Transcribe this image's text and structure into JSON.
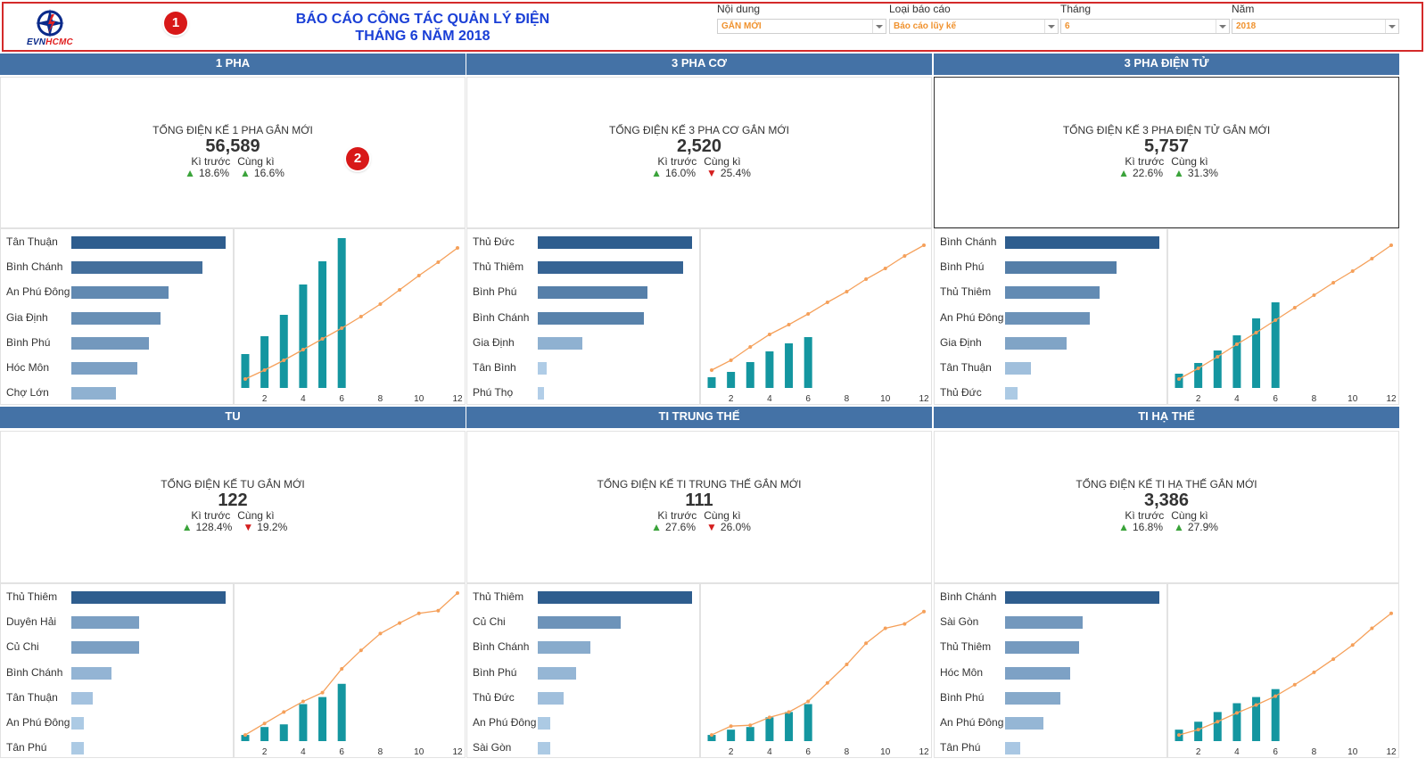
{
  "header": {
    "logo_text": {
      "evn": "EVN",
      "hcmc": "HCMC"
    },
    "title_line1": "BÁO CÁO CÔNG TÁC QUẢN LÝ ĐIỆN",
    "title_line2": "THÁNG 6 NĂM 2018",
    "badge1": "1",
    "badge2": "2",
    "filters": [
      {
        "label": "Nội dung",
        "value": "GẮN MỚI"
      },
      {
        "label": "Loại báo cáo",
        "value": "Báo cáo lũy kế"
      },
      {
        "label": "Tháng",
        "value": "6"
      },
      {
        "label": "Năm",
        "value": "2018"
      }
    ]
  },
  "colors": {
    "header_bar": "#4472a6",
    "bar_dark": "#2e5d8e",
    "bar_light": "#b7d3ec",
    "column": "#1496a0",
    "line": "#f5a05a",
    "up": "#3aa33a",
    "down": "#d41f1f"
  },
  "sections": [
    {
      "title": "1 PHA",
      "kpi_label": "TỔNG ĐIỆN KẾ 1 PHA GẮN MỚI",
      "kpi_value": "56,589",
      "prev_label": "Kì trước",
      "same_label": "Cùng kì",
      "prev_change": "18.6%",
      "prev_dir": "up",
      "same_change": "16.6%",
      "same_dir": "up"
    },
    {
      "title": "3 PHA CƠ",
      "kpi_label": "TỔNG ĐIỆN KẾ 3 PHA CƠ GẮN MỚI",
      "kpi_value": "2,520",
      "prev_label": "Kì trước",
      "same_label": "Cùng kì",
      "prev_change": "16.0%",
      "prev_dir": "up",
      "same_change": "25.4%",
      "same_dir": "down"
    },
    {
      "title": "3 PHA ĐIỆN TỬ",
      "kpi_label": "TỔNG ĐIỆN KẾ 3 PHA ĐIỆN TỬ GẮN MỚI",
      "kpi_value": "5,757",
      "prev_label": "Kì trước",
      "same_label": "Cùng kì",
      "prev_change": "22.6%",
      "prev_dir": "up",
      "same_change": "31.3%",
      "same_dir": "up"
    },
    {
      "title": "TU",
      "kpi_label": "TỔNG ĐIỆN KẾ TU GẮN MỚI",
      "kpi_value": "122",
      "prev_label": "Kì trước",
      "same_label": "Cùng kì",
      "prev_change": "128.4%",
      "prev_dir": "up",
      "same_change": "19.2%",
      "same_dir": "down"
    },
    {
      "title": "TI TRUNG THẾ",
      "kpi_label": "TỔNG ĐIỆN KẾ TI TRUNG THẾ GẮN MỚI",
      "kpi_value": "111",
      "prev_label": "Kì trước",
      "same_label": "Cùng kì",
      "prev_change": "27.6%",
      "prev_dir": "up",
      "same_change": "26.0%",
      "same_dir": "down"
    },
    {
      "title": "TI HẠ THẾ",
      "kpi_label": "TỔNG ĐIỆN KẾ TI HẠ THẾ GẮN MỚI",
      "kpi_value": "3,386",
      "prev_label": "Kì trước",
      "same_label": "Cùng kì",
      "prev_change": "16.8%",
      "prev_dir": "up",
      "same_change": "27.9%",
      "same_dir": "up"
    }
  ],
  "chart_data": [
    {
      "type": "bar",
      "orientation": "horizontal",
      "section": "1 PHA",
      "categories": [
        "Tân Thuận",
        "Bình Chánh",
        "An Phú Đông",
        "Gia Định",
        "Bình Phú",
        "Hóc Môn",
        "Chợ Lớn"
      ],
      "values": [
        100,
        85,
        63,
        58,
        50,
        43,
        29
      ]
    },
    {
      "type": "bar",
      "section": "1 PHA",
      "x": [
        1,
        2,
        3,
        4,
        5,
        6
      ],
      "values": [
        38,
        58,
        82,
        116,
        142,
        168
      ],
      "line_x": [
        1,
        2,
        3,
        4,
        5,
        6,
        7,
        8,
        9,
        10,
        11,
        12
      ],
      "line_values": [
        10,
        20,
        31,
        43,
        55,
        67,
        80,
        94,
        110,
        126,
        141,
        157
      ],
      "xticks": [
        2,
        4,
        6,
        8,
        10,
        12
      ]
    },
    {
      "type": "bar",
      "orientation": "horizontal",
      "section": "3 PHA CƠ",
      "categories": [
        "Thủ Đức",
        "Thủ Thiêm",
        "Bình Phú",
        "Bình Chánh",
        "Gia Định",
        "Tân Bình",
        "Phú Thọ"
      ],
      "values": [
        100,
        94,
        71,
        69,
        29,
        6,
        4
      ]
    },
    {
      "type": "bar",
      "section": "3 PHA CƠ",
      "x": [
        1,
        2,
        3,
        4,
        5,
        6
      ],
      "values": [
        12,
        18,
        29,
        41,
        50,
        57
      ],
      "line_x": [
        1,
        2,
        3,
        4,
        5,
        6,
        7,
        8,
        9,
        10,
        11,
        12
      ],
      "line_values": [
        20,
        31,
        46,
        60,
        71,
        83,
        96,
        108,
        122,
        134,
        148,
        160
      ],
      "xticks": [
        2,
        4,
        6,
        8,
        10,
        12
      ]
    },
    {
      "type": "bar",
      "orientation": "horizontal",
      "section": "3 PHA ĐIỆN TỬ",
      "categories": [
        "Bình Chánh",
        "Bình Phú",
        "Thủ Thiêm",
        "An Phú Đông",
        "Gia Định",
        "Tân Thuận",
        "Thủ Đức"
      ],
      "values": [
        100,
        72,
        61,
        55,
        40,
        17,
        8
      ]
    },
    {
      "type": "bar",
      "section": "3 PHA ĐIỆN TỬ",
      "x": [
        1,
        2,
        3,
        4,
        5,
        6
      ],
      "values": [
        16,
        28,
        42,
        59,
        78,
        96
      ],
      "line_x": [
        1,
        2,
        3,
        4,
        5,
        6,
        7,
        8,
        9,
        10,
        11,
        12
      ],
      "line_values": [
        10,
        22,
        35,
        49,
        62,
        76,
        90,
        104,
        118,
        131,
        145,
        160
      ],
      "xticks": [
        2,
        4,
        6,
        8,
        10,
        12
      ]
    },
    {
      "type": "bar",
      "orientation": "horizontal",
      "section": "TU",
      "categories": [
        "Thủ Thiêm",
        "Duyên Hải",
        "Củ Chi",
        "Bình Chánh",
        "Tân Thuận",
        "An Phú Đông",
        "Tân Phú"
      ],
      "values": [
        100,
        44,
        44,
        26,
        14,
        8,
        8
      ]
    },
    {
      "type": "bar",
      "section": "TU",
      "x": [
        1,
        2,
        3,
        4,
        5,
        6
      ],
      "values": [
        7,
        16,
        19,
        42,
        50,
        65
      ],
      "line_x": [
        1,
        2,
        3,
        4,
        5,
        6,
        7,
        8,
        9,
        10,
        11,
        12
      ],
      "line_values": [
        7,
        20,
        33,
        45,
        55,
        82,
        103,
        122,
        134,
        145,
        148,
        168
      ],
      "xticks": [
        2,
        4,
        6,
        8,
        10,
        12
      ]
    },
    {
      "type": "bar",
      "orientation": "horizontal",
      "section": "TI TRUNG THẾ",
      "categories": [
        "Thủ Thiêm",
        "Củ Chi",
        "Bình Chánh",
        "Bình Phú",
        "Thủ Đức",
        "An Phú Đông",
        "Sài Gòn"
      ],
      "values": [
        100,
        54,
        34,
        25,
        17,
        8,
        8
      ]
    },
    {
      "type": "bar",
      "section": "TI TRUNG THẾ",
      "x": [
        1,
        2,
        3,
        4,
        5,
        6
      ],
      "values": [
        7,
        13,
        16,
        27,
        33,
        42
      ],
      "line_x": [
        1,
        2,
        3,
        4,
        5,
        6,
        7,
        8,
        9,
        10,
        11,
        12
      ],
      "line_values": [
        7,
        17,
        18,
        27,
        33,
        45,
        66,
        87,
        111,
        128,
        133,
        147
      ],
      "xticks": [
        2,
        4,
        6,
        8,
        10,
        12
      ]
    },
    {
      "type": "bar",
      "orientation": "horizontal",
      "section": "TI HẠ THẾ",
      "categories": [
        "Bình Chánh",
        "Sài Gòn",
        "Thủ Thiêm",
        "Hóc Môn",
        "Bình Phú",
        "An Phú Đông",
        "Tân Phú"
      ],
      "values": [
        100,
        50,
        48,
        42,
        36,
        25,
        10
      ]
    },
    {
      "type": "bar",
      "section": "TI HẠ THẾ",
      "x": [
        1,
        2,
        3,
        4,
        5,
        6
      ],
      "values": [
        13,
        22,
        33,
        43,
        50,
        59
      ],
      "line_x": [
        1,
        2,
        3,
        4,
        5,
        6,
        7,
        8,
        9,
        10,
        11,
        12
      ],
      "line_values": [
        7,
        13,
        22,
        32,
        41,
        51,
        64,
        78,
        93,
        109,
        128,
        145
      ],
      "xticks": [
        2,
        4,
        6,
        8,
        10,
        12
      ]
    }
  ]
}
